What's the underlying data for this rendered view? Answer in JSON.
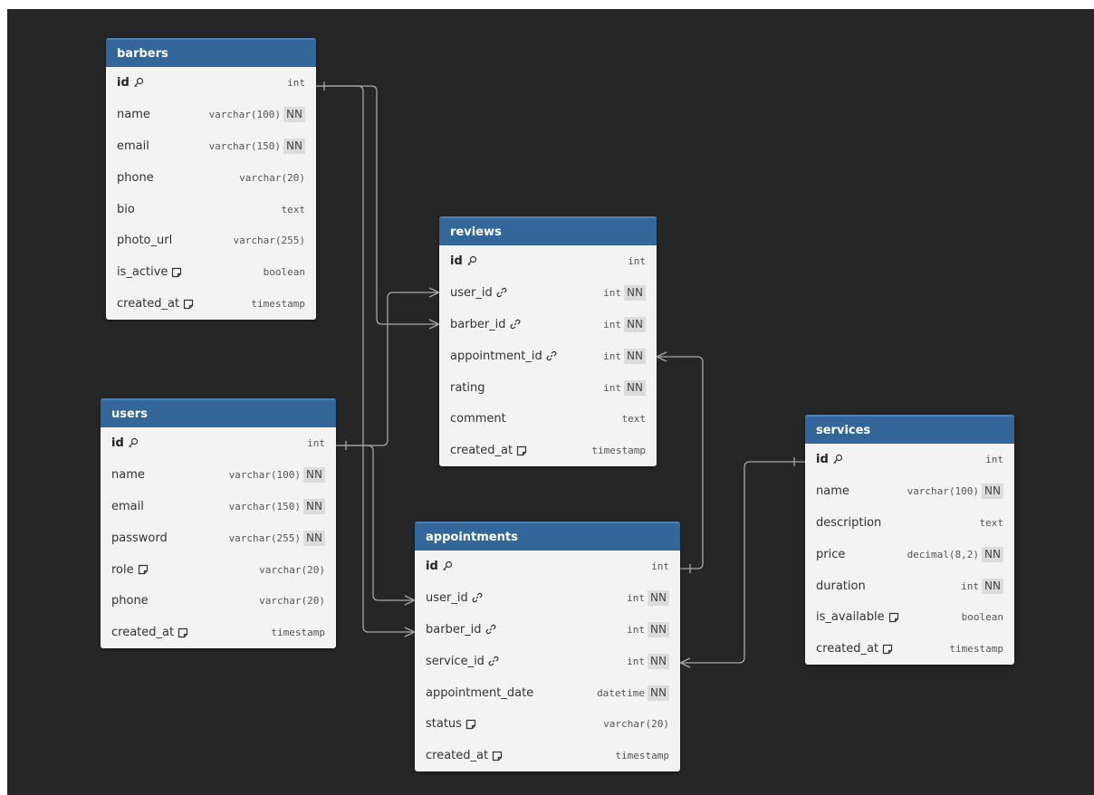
{
  "colors": {
    "canvas_background": "#262626",
    "table_header": "#336699",
    "table_body": "#f3f3f3",
    "relation_line": "#a9a9a9"
  },
  "tables": [
    {
      "id": "barbers",
      "name": "barbers",
      "columns": [
        {
          "name": "id",
          "type": "int",
          "pk": true,
          "icon": "key-icon"
        },
        {
          "name": "name",
          "type": "varchar(100)",
          "nn": "NN"
        },
        {
          "name": "email",
          "type": "varchar(150)",
          "nn": "NN"
        },
        {
          "name": "phone",
          "type": "varchar(20)"
        },
        {
          "name": "bio",
          "type": "text"
        },
        {
          "name": "photo_url",
          "type": "varchar(255)"
        },
        {
          "name": "is_active",
          "type": "boolean",
          "icon": "note-icon"
        },
        {
          "name": "created_at",
          "type": "timestamp",
          "icon": "note-icon"
        }
      ]
    },
    {
      "id": "reviews",
      "name": "reviews",
      "columns": [
        {
          "name": "id",
          "type": "int",
          "pk": true,
          "icon": "key-icon"
        },
        {
          "name": "user_id",
          "type": "int",
          "nn": "NN",
          "icon": "link-icon"
        },
        {
          "name": "barber_id",
          "type": "int",
          "nn": "NN",
          "icon": "link-icon"
        },
        {
          "name": "appointment_id",
          "type": "int",
          "nn": "NN",
          "icon": "link-icon"
        },
        {
          "name": "rating",
          "type": "int",
          "nn": "NN"
        },
        {
          "name": "comment",
          "type": "text"
        },
        {
          "name": "created_at",
          "type": "timestamp",
          "icon": "note-icon"
        }
      ]
    },
    {
      "id": "users",
      "name": "users",
      "columns": [
        {
          "name": "id",
          "type": "int",
          "pk": true,
          "icon": "key-icon"
        },
        {
          "name": "name",
          "type": "varchar(100)",
          "nn": "NN"
        },
        {
          "name": "email",
          "type": "varchar(150)",
          "nn": "NN"
        },
        {
          "name": "password",
          "type": "varchar(255)",
          "nn": "NN"
        },
        {
          "name": "role",
          "type": "varchar(20)",
          "icon": "note-icon"
        },
        {
          "name": "phone",
          "type": "varchar(20)"
        },
        {
          "name": "created_at",
          "type": "timestamp",
          "icon": "note-icon"
        }
      ]
    },
    {
      "id": "appointments",
      "name": "appointments",
      "columns": [
        {
          "name": "id",
          "type": "int",
          "pk": true,
          "icon": "key-icon"
        },
        {
          "name": "user_id",
          "type": "int",
          "nn": "NN",
          "icon": "link-icon"
        },
        {
          "name": "barber_id",
          "type": "int",
          "nn": "NN",
          "icon": "link-icon"
        },
        {
          "name": "service_id",
          "type": "int",
          "nn": "NN",
          "icon": "link-icon"
        },
        {
          "name": "appointment_date",
          "type": "datetime",
          "nn": "NN"
        },
        {
          "name": "status",
          "type": "varchar(20)",
          "icon": "note-icon"
        },
        {
          "name": "created_at",
          "type": "timestamp",
          "icon": "note-icon"
        }
      ]
    },
    {
      "id": "services",
      "name": "services",
      "columns": [
        {
          "name": "id",
          "type": "int",
          "pk": true,
          "icon": "key-icon"
        },
        {
          "name": "name",
          "type": "varchar(100)",
          "nn": "NN"
        },
        {
          "name": "description",
          "type": "text"
        },
        {
          "name": "price",
          "type": "decimal(8,2)",
          "nn": "NN"
        },
        {
          "name": "duration",
          "type": "int",
          "nn": "NN"
        },
        {
          "name": "is_available",
          "type": "boolean",
          "icon": "note-icon"
        },
        {
          "name": "created_at",
          "type": "timestamp",
          "icon": "note-icon"
        }
      ]
    }
  ],
  "relationships": [
    {
      "from": "barbers.id",
      "to": "reviews.barber_id",
      "cardinality": "one-to-many"
    },
    {
      "from": "barbers.id",
      "to": "appointments.barber_id",
      "cardinality": "one-to-many"
    },
    {
      "from": "users.id",
      "to": "reviews.user_id",
      "cardinality": "one-to-many"
    },
    {
      "from": "users.id",
      "to": "appointments.user_id",
      "cardinality": "one-to-many"
    },
    {
      "from": "appointments.id",
      "to": "reviews.appointment_id",
      "cardinality": "one-to-many"
    },
    {
      "from": "services.id",
      "to": "appointments.service_id",
      "cardinality": "one-to-many"
    }
  ]
}
